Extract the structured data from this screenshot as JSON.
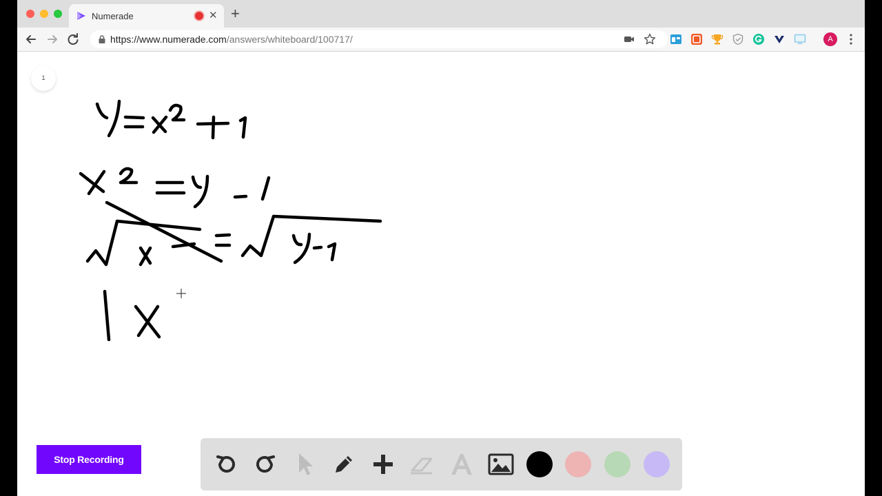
{
  "browser": {
    "tab_title": "Numerade",
    "tab_close": "✕",
    "new_tab": "+",
    "url_host": "https://www.numerade.com",
    "url_path": "/answers/whiteboard/100717/",
    "profile_initial": "A"
  },
  "whiteboard": {
    "page_number": "1"
  },
  "actions": {
    "stop_recording": "Stop Recording"
  },
  "tools": [
    {
      "name": "undo",
      "icon": "undo-icon"
    },
    {
      "name": "redo",
      "icon": "redo-icon"
    },
    {
      "name": "select",
      "icon": "cursor-icon"
    },
    {
      "name": "pen",
      "icon": "pencil-icon"
    },
    {
      "name": "add",
      "icon": "plus-icon"
    },
    {
      "name": "eraser",
      "icon": "eraser-icon"
    },
    {
      "name": "text",
      "icon": "text-icon"
    },
    {
      "name": "image",
      "icon": "image-icon"
    }
  ],
  "colors": {
    "accent": "#7207fe",
    "swatches": [
      "#000000",
      "#eeb3b3",
      "#b7d9b5",
      "#c7b9f5"
    ]
  }
}
